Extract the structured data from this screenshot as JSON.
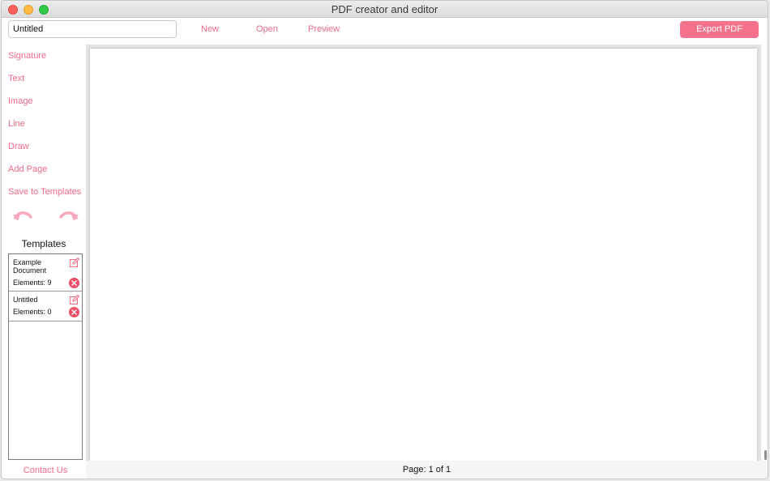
{
  "window": {
    "title": "PDF creator and editor"
  },
  "toolbar": {
    "document_name": "Untitled",
    "new_label": "New",
    "open_label": "Open",
    "preview_label": "Preview",
    "export_label": "Export PDF"
  },
  "sidebar": {
    "tools": [
      "Signature",
      "Text",
      "Image",
      "Line",
      "Draw",
      "Add Page",
      "Save to Templates"
    ],
    "undo_icon": "undo-arrow",
    "redo_icon": "redo-arrow",
    "templates_title": "Templates",
    "templates": [
      {
        "name": "Example Document",
        "elements": "Elements: 9"
      },
      {
        "name": "Untitled",
        "elements": "Elements: 0"
      }
    ],
    "contact_label": "Contact Us"
  },
  "status": {
    "page_indicator": "Page: 1 of 1"
  },
  "colors": {
    "accent": "#f06a86",
    "button": "#f4728c",
    "delete": "#ec4d68"
  }
}
